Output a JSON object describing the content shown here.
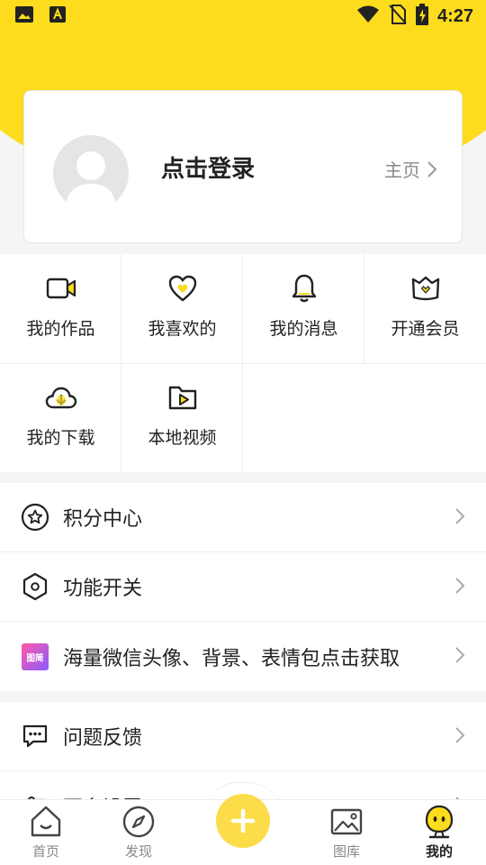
{
  "status_bar": {
    "time": "4:27"
  },
  "profile": {
    "login_text": "点击登录",
    "home_link": "主页"
  },
  "grid": {
    "items": [
      {
        "label": "我的作品",
        "icon": "video-camera-icon"
      },
      {
        "label": "我喜欢的",
        "icon": "heart-icon"
      },
      {
        "label": "我的消息",
        "icon": "bell-icon"
      },
      {
        "label": "开通会员",
        "icon": "vip-crown-icon"
      },
      {
        "label": "我的下载",
        "icon": "cloud-download-icon"
      },
      {
        "label": "本地视频",
        "icon": "folder-video-icon"
      }
    ]
  },
  "menu_groups": [
    {
      "items": [
        {
          "label": "积分中心",
          "icon": "points-star-icon"
        },
        {
          "label": "功能开关",
          "icon": "hexagon-settings-icon"
        },
        {
          "label": "海量微信头像、背景、表情包点击获取",
          "icon": "app-logo-icon",
          "badge_text": "图简"
        }
      ]
    },
    {
      "items": [
        {
          "label": "问题反馈",
          "icon": "feedback-chat-icon"
        },
        {
          "label": "更多设置",
          "icon": "more-settings-icon"
        }
      ]
    }
  ],
  "bottom_nav": [
    {
      "label": "首页",
      "icon": "home-icon"
    },
    {
      "label": "发现",
      "icon": "compass-icon"
    },
    {
      "label": "图库",
      "icon": "gallery-icon"
    },
    {
      "label": "我的",
      "icon": "mine-face-icon",
      "active": true
    }
  ],
  "colors": {
    "accent": "#fcdc1c",
    "button": "#fcdc48"
  }
}
